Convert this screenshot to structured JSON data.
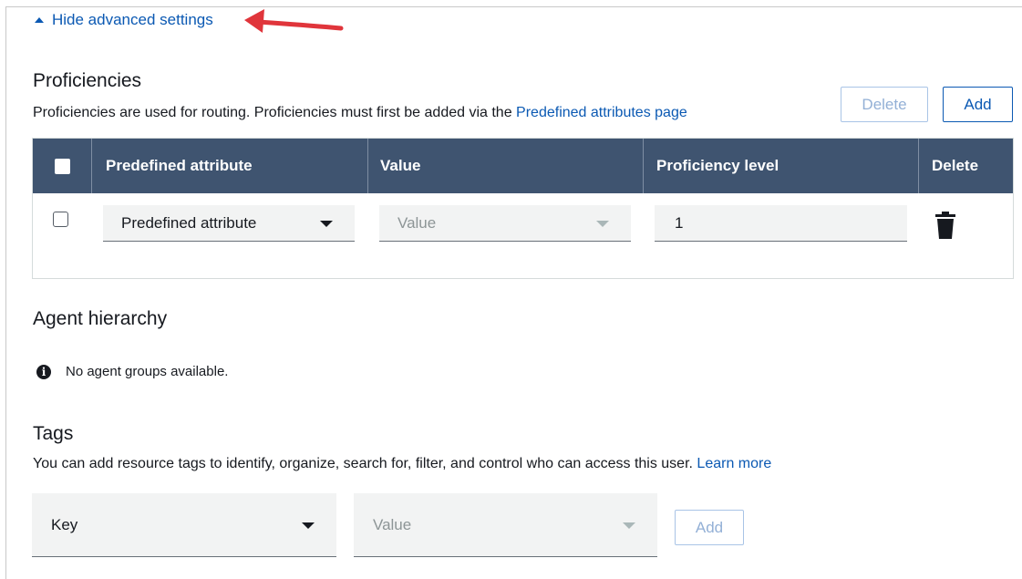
{
  "advanced_toggle": {
    "label": "Hide advanced settings"
  },
  "proficiencies": {
    "title": "Proficiencies",
    "description": "Proficiencies are used for routing. Proficiencies must first be added via the ",
    "link_text": "Predefined attributes page",
    "delete_button": "Delete",
    "add_button": "Add",
    "columns": [
      "Predefined attribute",
      "Value",
      "Proficiency level",
      "Delete"
    ],
    "row": {
      "attribute_placeholder": "Predefined attribute",
      "value_placeholder": "Value",
      "proficiency_level": "1"
    }
  },
  "agent_hierarchy": {
    "title": "Agent hierarchy",
    "info": "No agent groups available."
  },
  "tags": {
    "title": "Tags",
    "description": "You can add resource tags to identify, organize, search for, filter, and control who can access this user. ",
    "link_text": "Learn more",
    "key_placeholder": "Key",
    "value_placeholder": "Value",
    "add_button": "Add"
  },
  "icons": [
    "caret-up-icon",
    "caret-down-icon",
    "trash-icon",
    "info-icon",
    "annotation-arrow"
  ],
  "colors": {
    "link": "#0b59b3",
    "header_bg": "#3f5470",
    "arrow": "#e0353b"
  }
}
